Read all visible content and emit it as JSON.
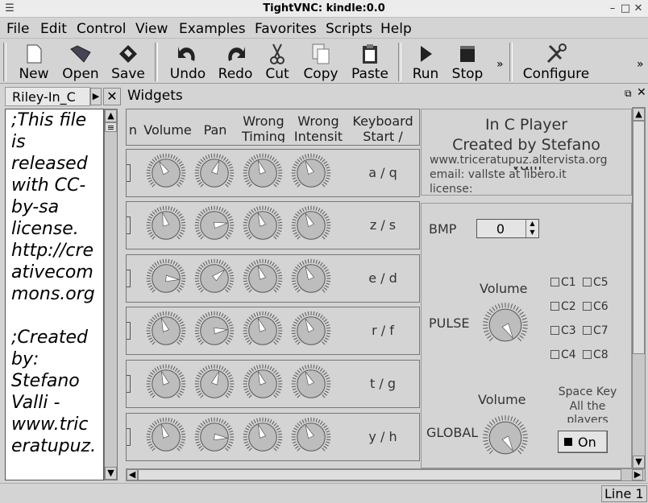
{
  "window": {
    "title": "TightVNC: kindle:0.0"
  },
  "menu": [
    "File",
    "Edit",
    "Control",
    "View",
    "Examples",
    "Favorites",
    "Scripts",
    "Help"
  ],
  "toolbar": {
    "buttons": [
      {
        "label": "New",
        "icon": "new-icon"
      },
      {
        "label": "Open",
        "icon": "open-icon"
      },
      {
        "label": "Save",
        "icon": "save-icon"
      },
      {
        "label": "Undo",
        "icon": "undo-icon"
      },
      {
        "label": "Redo",
        "icon": "redo-icon"
      },
      {
        "label": "Cut",
        "icon": "cut-icon"
      },
      {
        "label": "Copy",
        "icon": "copy-icon"
      },
      {
        "label": "Paste",
        "icon": "paste-icon"
      },
      {
        "label": "Run",
        "icon": "run-icon"
      },
      {
        "label": "Stop",
        "icon": "stop-icon"
      },
      {
        "label": "Configure",
        "icon": "configure-icon"
      }
    ],
    "overflow": "»"
  },
  "left_panel": {
    "tab_label": "Riley-In_C",
    "text_lines": [
      ";This file",
      "is",
      "released",
      "with CC-",
      "by-sa",
      "license.",
      "http://cre",
      "ativecom",
      "mons.org",
      "",
      ";Created",
      "by:",
      "Stefano",
      "Valli  -",
      "www.tric",
      "eratupuz."
    ]
  },
  "widgets": {
    "title": "Widgets",
    "headers": {
      "col0": "n",
      "volume": "Volume",
      "pan": "Pan",
      "wrong_timing": "Wrong\nTiming",
      "wrong_intensity": "Wrong\nIntensit",
      "keyboard": "Keyboard\nStart /"
    },
    "rows": [
      {
        "keys": "a / q",
        "vol": -30,
        "pan": 20,
        "wt": -20,
        "wi": -25
      },
      {
        "keys": "z / s",
        "vol": -15,
        "pan": 80,
        "wt": -20,
        "wi": -25
      },
      {
        "keys": "e / d",
        "vol": 95,
        "pan": 50,
        "wt": -20,
        "wi": -25
      },
      {
        "keys": "r / f",
        "vol": -20,
        "pan": 85,
        "wt": -20,
        "wi": -25
      },
      {
        "keys": "t / g",
        "vol": -20,
        "pan": 20,
        "wt": -20,
        "wi": -25
      },
      {
        "keys": "y / h",
        "vol": -20,
        "pan": 95,
        "wt": -20,
        "wi": -25
      }
    ]
  },
  "info": {
    "title_line1": "In C Player",
    "title_line2": "Created by Stefano",
    "title_line3": "Valli",
    "url": "www.triceratupuz.altervista.org",
    "email": "email: vallste at libero.it",
    "license": "license:"
  },
  "controls": {
    "bmp_label": "BMP",
    "bmp_value": "0",
    "pulse_label": "PULSE",
    "volume_label_1": "Volume",
    "global_label": "GLOBAL",
    "volume_label_2": "Volume",
    "checkboxes": [
      "C1",
      "C5",
      "C2",
      "C6",
      "C3",
      "C7",
      "C4",
      "C8"
    ],
    "space_key_1": "Space Key",
    "space_key_2": "All the",
    "space_key_3": "players",
    "on_button": "On",
    "pulse_knob": 150,
    "global_knob": 150
  },
  "status": {
    "line": "Line 1"
  }
}
